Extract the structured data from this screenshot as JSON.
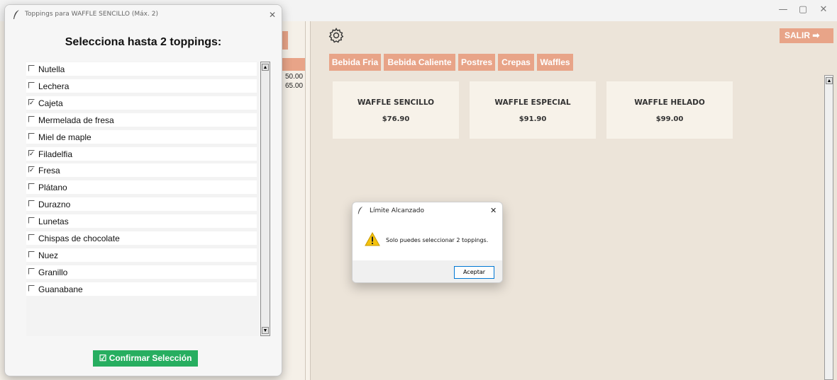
{
  "main_window": {
    "window_controls": {
      "minimize": "—",
      "maximize": "▢",
      "close": "✕"
    },
    "exit_label": "SALIR ➡",
    "categories": [
      "Bebida Fria",
      "Bebida Caliente",
      "Postres",
      "Crepas",
      "Waffles"
    ],
    "products": [
      {
        "name": "WAFFLE SENCILLO",
        "price": "$76.90"
      },
      {
        "name": "WAFFLE ESPECIAL",
        "price": "$91.90"
      },
      {
        "name": "WAFFLE HELADO",
        "price": "$99.00"
      }
    ],
    "peek_values": [
      "50.00",
      "65.00"
    ]
  },
  "toppings_dialog": {
    "title": "Toppings para WAFFLE SENCILLO (Máx. 2)",
    "close": "✕",
    "heading": "Selecciona hasta 2 toppings:",
    "toppings": [
      {
        "label": "Nutella",
        "checked": false
      },
      {
        "label": "Lechera",
        "checked": false
      },
      {
        "label": "Cajeta",
        "checked": true
      },
      {
        "label": "Mermelada de fresa",
        "checked": false
      },
      {
        "label": "Miel de maple",
        "checked": false
      },
      {
        "label": "Filadelfia",
        "checked": true
      },
      {
        "label": "Fresa",
        "checked": true
      },
      {
        "label": "Plátano",
        "checked": false
      },
      {
        "label": "Durazno",
        "checked": false
      },
      {
        "label": "Lunetas",
        "checked": false
      },
      {
        "label": "Chispas de chocolate",
        "checked": false
      },
      {
        "label": "Nuez",
        "checked": false
      },
      {
        "label": "Granillo",
        "checked": false
      },
      {
        "label": "Guanabane",
        "checked": false
      }
    ],
    "scroll_up": "▲",
    "scroll_down": "▼",
    "confirm_icon": "☑",
    "confirm_label": "Confirmar Selección"
  },
  "alert_dialog": {
    "title": "Límite Alcanzado",
    "close": "✕",
    "message": "Solo puedes seleccionar 2 toppings.",
    "accept_label": "Aceptar"
  },
  "colors": {
    "accent": "#e8a488",
    "confirm_green": "#27ae60",
    "background": "#ece4d9",
    "card": "#f7f2e9"
  }
}
